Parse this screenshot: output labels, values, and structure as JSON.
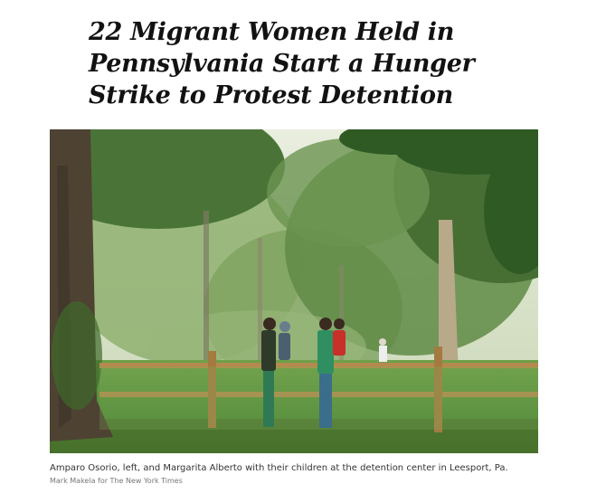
{
  "article": {
    "headline": "22 Migrant Women Held in Pennsylvania Start a Hunger Strike to Protest Detention",
    "image": {
      "caption": "Amparo Osorio, left, and Margarita Alberto with their children at the detention center in Leesport, Pa.",
      "credit": "Mark Makela for The New York Times"
    }
  }
}
